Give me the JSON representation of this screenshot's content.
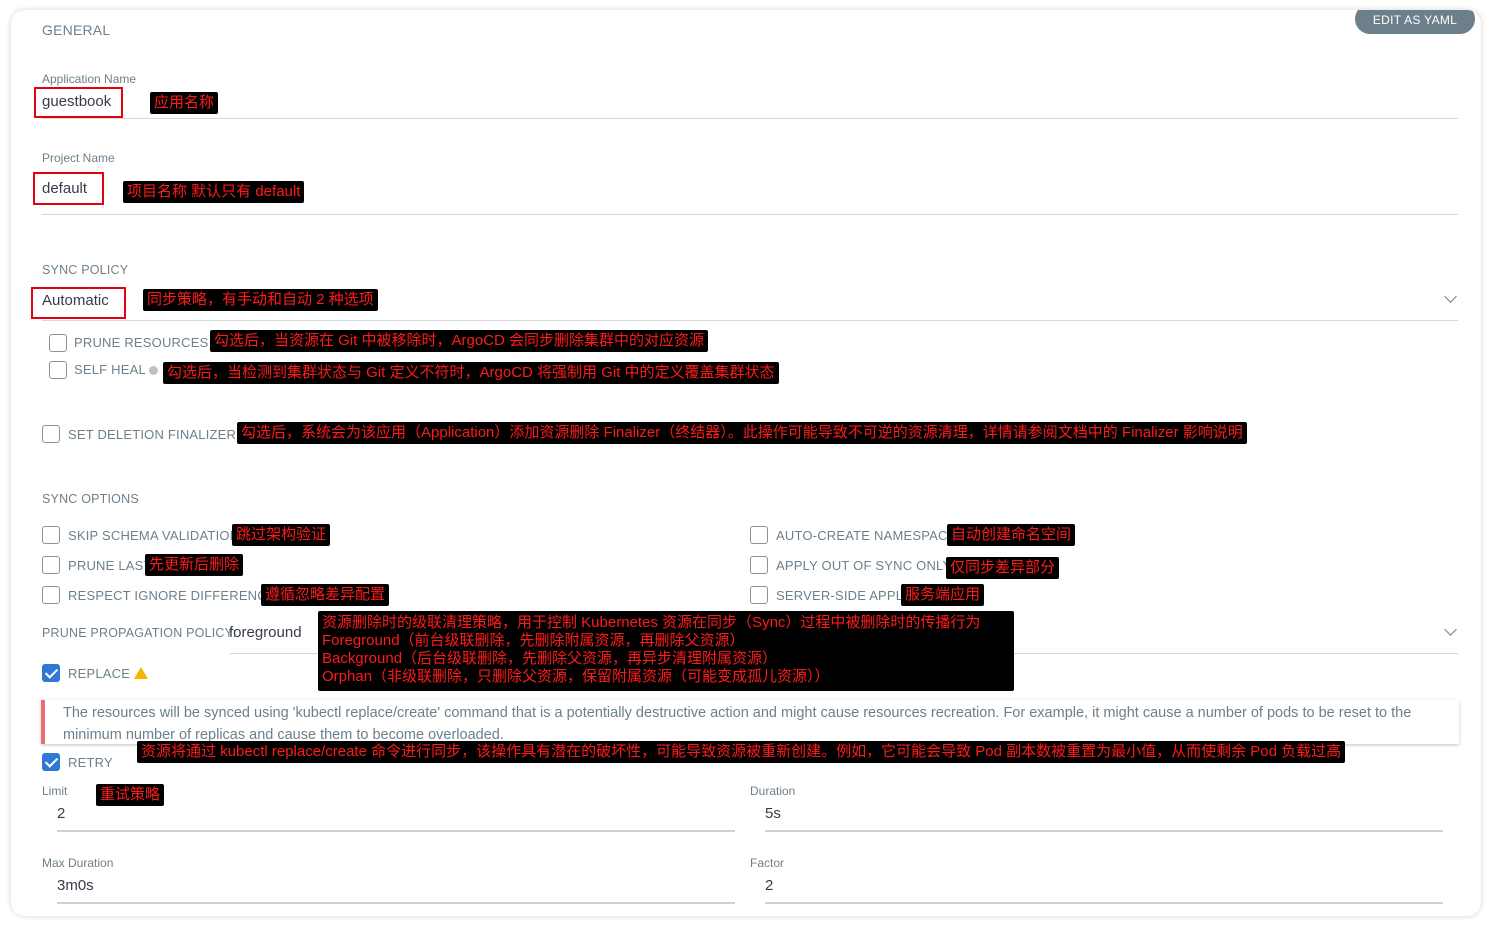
{
  "toolbar": {
    "edit_yaml_label": "EDIT AS YAML"
  },
  "general": {
    "title": "GENERAL",
    "app_name": {
      "label": "Application Name",
      "value": "guestbook",
      "note": "应用名称"
    },
    "project_name": {
      "label": "Project Name",
      "value": "default",
      "note": "项目名称 默认只有 default"
    }
  },
  "sync_policy": {
    "title": "SYNC POLICY",
    "value": "Automatic",
    "note": "同步策略，有手动和自动 2 种选项",
    "prune_resources": {
      "label": "PRUNE RESOURCES",
      "checked": false,
      "note": "勾选后，当资源在 Git 中被移除时，ArgoCD 会同步删除集群中的对应资源"
    },
    "self_heal": {
      "label": "SELF HEAL",
      "checked": false,
      "note": "勾选后，当检测到集群状态与 Git 定义不符时，ArgoCD 将强制用 Git 中的定义覆盖集群状态"
    }
  },
  "deletion_finalizer": {
    "label": "SET DELETION FINALIZER",
    "checked": false,
    "note": "勾选后，系统会为该应用（Application）添加资源删除 Finalizer（终结器）。此操作可能导致不可逆的资源清理，详情请参阅文档中的 Finalizer 影响说明"
  },
  "sync_options": {
    "title": "SYNC OPTIONS",
    "skip_schema": {
      "label": "SKIP SCHEMA VALIDATION",
      "checked": false,
      "note": "跳过架构验证"
    },
    "prune_last": {
      "label": "PRUNE LAST",
      "checked": false,
      "note": "先更新后删除"
    },
    "respect_ignore": {
      "label": "RESPECT IGNORE DIFFERENCES",
      "checked": false,
      "note": "遵循忽略差异配置"
    },
    "auto_create_ns": {
      "label": "AUTO-CREATE NAMESPACE",
      "checked": false,
      "note": "自动创建命名空间"
    },
    "apply_out_of_sync": {
      "label": "APPLY OUT OF SYNC ONLY",
      "checked": false,
      "note": "仅同步差异部分"
    },
    "server_side_apply": {
      "label": "SERVER-SIDE APPLY",
      "checked": false,
      "note": "服务端应用"
    }
  },
  "prune_propagation": {
    "label": "PRUNE PROPAGATION POLICY:",
    "value": "foreground",
    "note": "资源删除时的级联清理策略，用于控制 Kubernetes 资源在同步（Sync）过程中被删除时的传播行为\nForeground（前台级联删除，先删除附属资源，再删除父资源）\nBackground（后台级联删除，先删除父资源，再异步清理附属资源）\nOrphan（非级联删除，只删除父资源，保留附属资源（可能变成孤儿资源））"
  },
  "replace": {
    "label": "REPLACE",
    "checked": true,
    "warning": "The resources will be synced using 'kubectl replace/create' command that is a potentially destructive action and might cause resources recreation. For example, it might cause a number of pods to be reset to the minimum number of replicas and cause them to become overloaded.",
    "note": "资源将通过 kubectl replace/create 命令进行同步，该操作具有潜在的破坏性，可能导致资源被重新创建。例如，它可能会导致 Pod 副本数被重置为最小值，从而使剩余 Pod 负载过高"
  },
  "retry": {
    "label": "RETRY",
    "checked": true,
    "note": "重试策略",
    "limit": {
      "label": "Limit",
      "value": "2"
    },
    "duration": {
      "label": "Duration",
      "value": "5s"
    },
    "max_duration": {
      "label": "Max Duration",
      "value": "3m0s"
    },
    "factor": {
      "label": "Factor",
      "value": "2"
    }
  },
  "colors": {
    "accent": "#2f78d6",
    "annotation_text": "#ff1a1a",
    "annotation_bg": "#000000",
    "highlight_border": "#e3000f",
    "warning": "#f5b400"
  }
}
